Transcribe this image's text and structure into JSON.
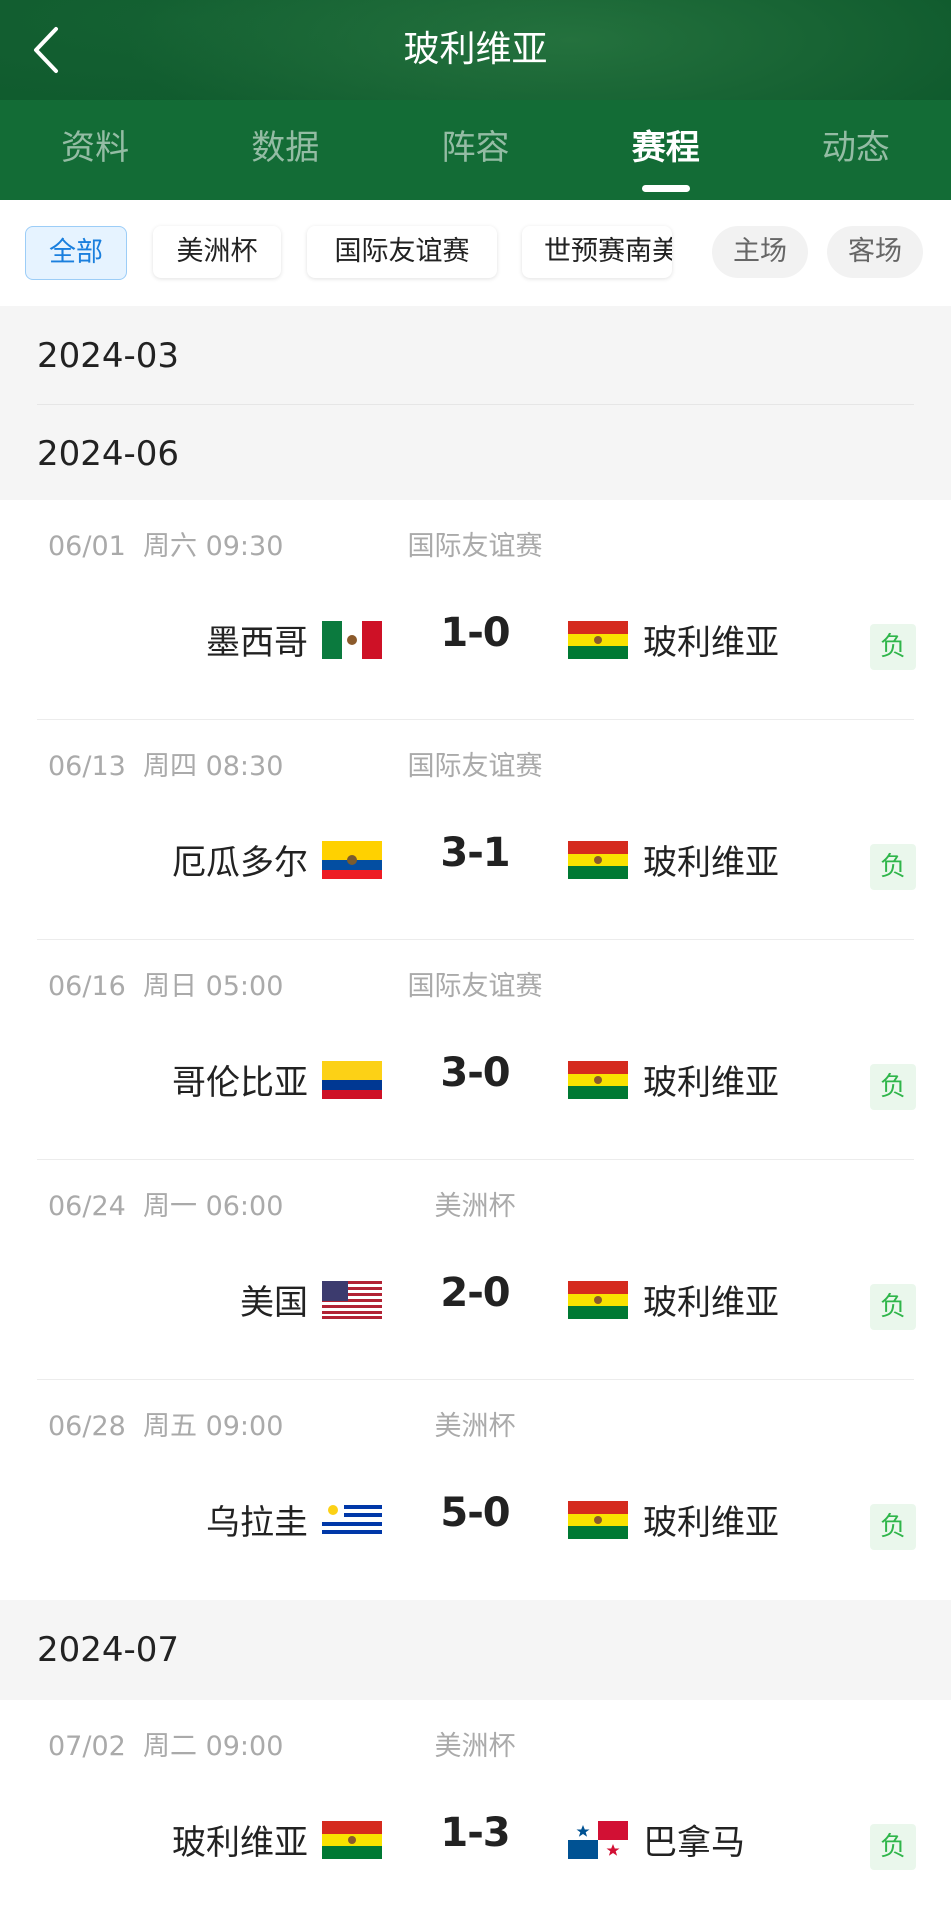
{
  "header": {
    "title": "玻利维亚",
    "tabs": [
      {
        "label": "资料",
        "active": false
      },
      {
        "label": "数据",
        "active": false
      },
      {
        "label": "阵容",
        "active": false
      },
      {
        "label": "赛程",
        "active": true
      },
      {
        "label": "动态",
        "active": false
      }
    ]
  },
  "filters": [
    {
      "label": "全部",
      "active": true
    },
    {
      "label": "美洲杯",
      "active": false
    },
    {
      "label": "国际友谊赛",
      "active": false
    },
    {
      "label": "世预赛南美",
      "active": false
    },
    {
      "label": "主场",
      "active": false
    },
    {
      "label": "客场",
      "active": false
    }
  ],
  "months": [
    "2024-03",
    "2024-06",
    "2024-07"
  ],
  "matches": [
    {
      "date": "06/01",
      "weekday": "周六",
      "time": "09:30",
      "competition": "国际友谊赛",
      "home": "墨西哥",
      "home_flag": "mexico-flag",
      "score": "1-0",
      "away": "玻利维亚",
      "away_flag": "bolivia-flag",
      "result": "负"
    },
    {
      "date": "06/13",
      "weekday": "周四",
      "time": "08:30",
      "competition": "国际友谊赛",
      "home": "厄瓜多尔",
      "home_flag": "ecuador-flag",
      "score": "3-1",
      "away": "玻利维亚",
      "away_flag": "bolivia-flag",
      "result": "负"
    },
    {
      "date": "06/16",
      "weekday": "周日",
      "time": "05:00",
      "competition": "国际友谊赛",
      "home": "哥伦比亚",
      "home_flag": "colombia-flag",
      "score": "3-0",
      "away": "玻利维亚",
      "away_flag": "bolivia-flag",
      "result": "负"
    },
    {
      "date": "06/24",
      "weekday": "周一",
      "time": "06:00",
      "competition": "美洲杯",
      "home": "美国",
      "home_flag": "usa-flag",
      "score": "2-0",
      "away": "玻利维亚",
      "away_flag": "bolivia-flag",
      "result": "负"
    },
    {
      "date": "06/28",
      "weekday": "周五",
      "time": "09:00",
      "competition": "美洲杯",
      "home": "乌拉圭",
      "home_flag": "uruguay-flag",
      "score": "5-0",
      "away": "玻利维亚",
      "away_flag": "bolivia-flag",
      "result": "负"
    },
    {
      "date": "07/02",
      "weekday": "周二",
      "time": "09:00",
      "competition": "美洲杯",
      "home": "玻利维亚",
      "home_flag": "bolivia-flag",
      "score": "1-3",
      "away": "巴拿马",
      "away_flag": "panama-flag",
      "result": "负"
    }
  ],
  "colors": {
    "header_green": "#0f5a2d",
    "tab_bar_green": "#136c36",
    "active_chip_blue": "#1a7fde",
    "loss_green": "#2fb54a"
  }
}
